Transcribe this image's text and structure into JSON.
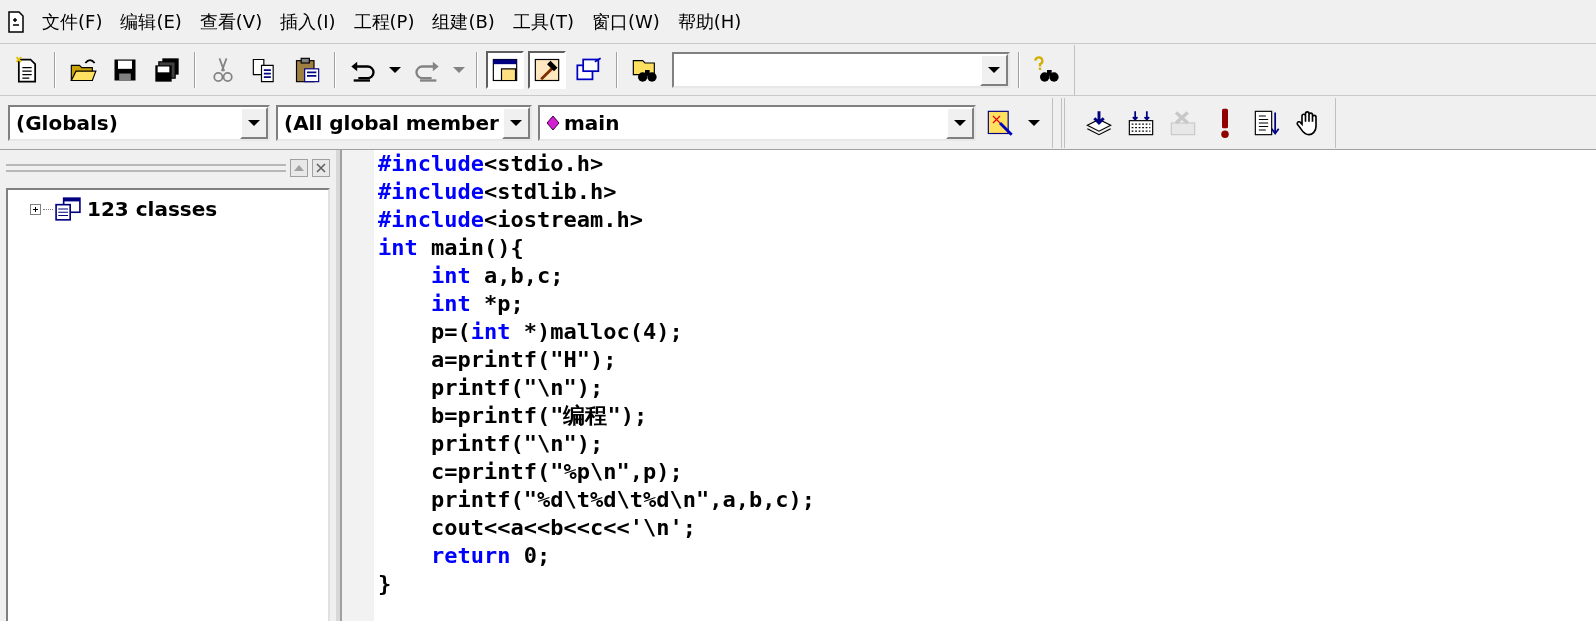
{
  "menu": [
    {
      "label": "文件(F)"
    },
    {
      "label": "编辑(E)"
    },
    {
      "label": "查看(V)"
    },
    {
      "label": "插入(I)"
    },
    {
      "label": "工程(P)"
    },
    {
      "label": "组建(B)"
    },
    {
      "label": "工具(T)"
    },
    {
      "label": "窗口(W)"
    },
    {
      "label": "帮助(H)"
    }
  ],
  "standard_toolbar": [
    [
      {
        "kind": "new",
        "disabled": false,
        "pressed": false
      }
    ],
    [
      {
        "kind": "open",
        "disabled": false,
        "pressed": false
      },
      {
        "kind": "save",
        "disabled": false,
        "pressed": false
      },
      {
        "kind": "save_all",
        "disabled": false,
        "pressed": false
      }
    ],
    [
      {
        "kind": "cut",
        "disabled": true,
        "pressed": false
      },
      {
        "kind": "copy",
        "disabled": false,
        "pressed": false
      },
      {
        "kind": "paste",
        "disabled": false,
        "pressed": false
      }
    ],
    [
      {
        "kind": "undo",
        "disabled": false,
        "pressed": false
      },
      {
        "kind": "dropdown",
        "disabled": false,
        "pressed": false
      },
      {
        "kind": "redo",
        "disabled": true,
        "pressed": false
      },
      {
        "kind": "dropdown",
        "disabled": true,
        "pressed": false
      }
    ],
    [
      {
        "kind": "workspace",
        "disabled": false,
        "pressed": true
      },
      {
        "kind": "output",
        "disabled": false,
        "pressed": true
      },
      {
        "kind": "windows",
        "disabled": false,
        "pressed": false
      }
    ],
    [
      {
        "kind": "find_in_files",
        "disabled": false,
        "pressed": false
      }
    ],
    [
      {
        "kind": "help_search",
        "disabled": false,
        "pressed": false
      }
    ]
  ],
  "wizard_bar": {
    "class_combo": "(Globals)",
    "filter_combo": "(All global member",
    "member_combo": "main"
  },
  "build_toolbar": [
    {
      "kind": "compile",
      "disabled": false
    },
    {
      "kind": "build",
      "disabled": false
    },
    {
      "kind": "stop",
      "disabled": true
    },
    {
      "kind": "execute",
      "disabled": false
    },
    {
      "kind": "go",
      "disabled": false
    },
    {
      "kind": "breakpoint",
      "disabled": false
    }
  ],
  "workspace": {
    "tree": [
      {
        "label": "123 classes",
        "expanded": false
      }
    ]
  },
  "editor": {
    "lines": [
      [
        {
          "text": "#include",
          "kind": "keyword"
        },
        {
          "text": "<stdio.h>",
          "kind": "plain"
        }
      ],
      [
        {
          "text": "#include",
          "kind": "keyword"
        },
        {
          "text": "<stdlib.h>",
          "kind": "plain"
        }
      ],
      [
        {
          "text": "#include",
          "kind": "keyword"
        },
        {
          "text": "<iostream.h>",
          "kind": "plain"
        }
      ],
      [
        {
          "text": "int",
          "kind": "keyword"
        },
        {
          "text": " main(){",
          "kind": "plain"
        }
      ],
      {
        "children": [
          [
            {
              "text": "int",
              "kind": "keyword"
            },
            {
              "text": " a,b,c;",
              "kind": "plain"
            }
          ],
          [
            {
              "text": "int",
              "kind": "keyword"
            },
            {
              "text": " *p;",
              "kind": "plain"
            }
          ],
          [
            {
              "text": "p=(",
              "kind": "plain"
            },
            {
              "text": "int",
              "kind": "keyword"
            },
            {
              "text": " *)malloc(4);",
              "kind": "plain"
            }
          ],
          [
            {
              "text": "a=printf(\"H\");",
              "kind": "plain"
            }
          ],
          [
            {
              "text": "printf(\"\\n\");",
              "kind": "plain"
            }
          ],
          [
            {
              "text": "b=printf(\"编程\");",
              "kind": "plain"
            }
          ],
          [
            {
              "text": "printf(\"\\n\");",
              "kind": "plain"
            }
          ],
          [
            {
              "text": "c=printf(\"%p\\n\",p);",
              "kind": "plain"
            }
          ],
          [
            {
              "text": "printf(\"%d\\t%d\\t%d\\n\",a,b,c);",
              "kind": "plain"
            }
          ],
          [
            {
              "text": "cout<<a<<b<<c<<'\\n';",
              "kind": "plain"
            }
          ],
          [
            {
              "text": "return",
              "kind": "keyword"
            },
            {
              "text": " 0;",
              "kind": "plain"
            }
          ]
        ]
      },
      [
        {
          "text": "}",
          "kind": "plain"
        }
      ]
    ]
  }
}
